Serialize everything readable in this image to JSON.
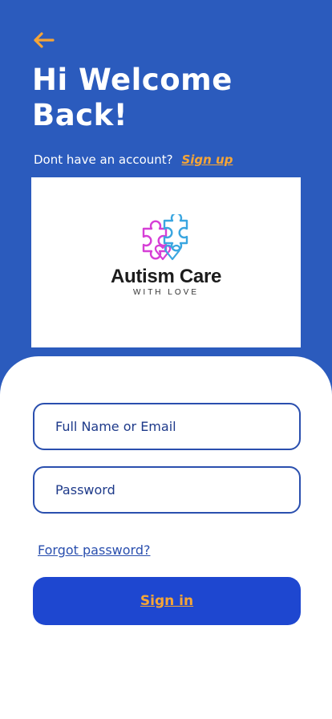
{
  "header": {
    "back_icon": "arrow-left-icon",
    "title": "Hi Welcome Back!",
    "signup_prompt": "Dont have an account?",
    "signup_link": "Sign up"
  },
  "logo": {
    "name": "Autism Care",
    "tagline": "WITH LOVE",
    "icon": "puzzle-heart-icon"
  },
  "form": {
    "name_placeholder": "Full Name or Email",
    "password_placeholder": "Password",
    "forgot_link": "Forgot password?",
    "submit_label": "Sign in"
  },
  "colors": {
    "background": "#2b5bbd",
    "accent": "#f5a537",
    "button": "#1e47d0",
    "field_border": "#2a4fae"
  }
}
